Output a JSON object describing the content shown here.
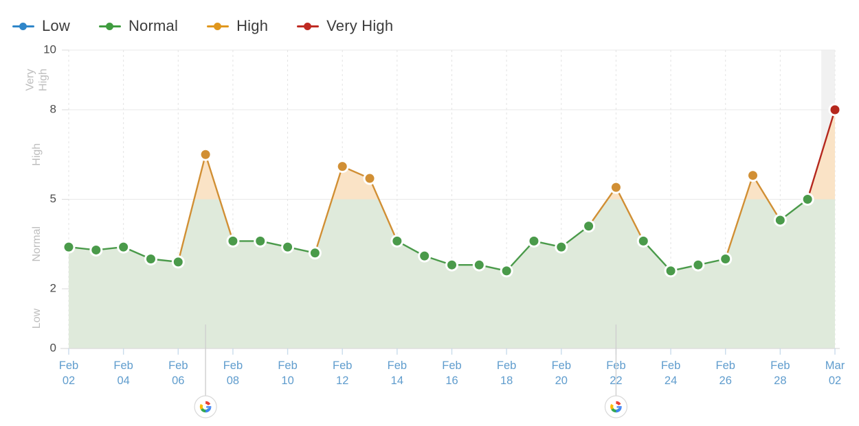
{
  "legend": {
    "items": [
      {
        "label": "Low",
        "color": "#2f86c9"
      },
      {
        "label": "Normal",
        "color": "#3f9c3f"
      },
      {
        "label": "High",
        "color": "#e0971d"
      },
      {
        "label": "Very High",
        "color": "#bf2a22"
      }
    ]
  },
  "colors": {
    "low_band": "#d5e4f0",
    "normal_band": "#dfeadb",
    "high_fill": "#fae3c6",
    "low_line": "#2f86c9",
    "normal_line": "#4a9a4a",
    "high_line": "#d18f34",
    "very_high_line": "#b5281e",
    "axis_label": "#5f9ccd",
    "grid": "#e8e8e8",
    "today_shade": "#ececec"
  },
  "chart_data": {
    "type": "line",
    "title": "",
    "xlabel": "",
    "ylabel": "",
    "ylim": [
      0,
      10
    ],
    "yticks": [
      0,
      2,
      5,
      8,
      10
    ],
    "grid": true,
    "legend_position": "top-left",
    "band_labels": [
      {
        "label": "Low",
        "from": 0,
        "to": 2
      },
      {
        "label": "Normal",
        "from": 2,
        "to": 5
      },
      {
        "label": "High",
        "from": 5,
        "to": 8
      },
      {
        "label": "Very High",
        "from": 8,
        "to": 10
      }
    ],
    "x_tick_labels": [
      "Feb\n02",
      "Feb\n04",
      "Feb\n06",
      "Feb\n08",
      "Feb\n10",
      "Feb\n12",
      "Feb\n14",
      "Feb\n16",
      "Feb\n18",
      "Feb\n20",
      "Feb\n22",
      "Feb\n24",
      "Feb\n26",
      "Feb\n28",
      "Mar\n02"
    ],
    "x": [
      "Feb 02",
      "Feb 03",
      "Feb 04",
      "Feb 05",
      "Feb 06",
      "Feb 07",
      "Feb 08",
      "Feb 09",
      "Feb 10",
      "Feb 11",
      "Feb 12",
      "Feb 13",
      "Feb 14",
      "Feb 15",
      "Feb 16",
      "Feb 17",
      "Feb 18",
      "Feb 19",
      "Feb 20",
      "Feb 21",
      "Feb 22",
      "Feb 23",
      "Feb 24",
      "Feb 25",
      "Feb 26",
      "Feb 27",
      "Feb 28",
      "Mar 01",
      "Mar 02"
    ],
    "values": [
      3.4,
      3.3,
      3.4,
      3.0,
      2.9,
      6.5,
      3.6,
      3.6,
      3.4,
      3.2,
      6.1,
      5.7,
      3.6,
      3.1,
      2.8,
      2.8,
      2.6,
      3.6,
      3.4,
      4.1,
      5.4,
      3.6,
      2.6,
      2.8,
      3.0,
      5.8,
      4.3,
      5.0,
      8.0
    ],
    "point_levels": [
      "normal",
      "normal",
      "normal",
      "normal",
      "normal",
      "high",
      "normal",
      "normal",
      "normal",
      "normal",
      "high",
      "high",
      "normal",
      "normal",
      "normal",
      "normal",
      "normal",
      "normal",
      "normal",
      "normal",
      "high",
      "normal",
      "normal",
      "normal",
      "normal",
      "high",
      "normal",
      "normal",
      "very_high"
    ],
    "events": [
      {
        "x": "Feb 07",
        "icon": "google-icon",
        "label": "Google update"
      },
      {
        "x": "Feb 22",
        "icon": "google-icon",
        "label": "Google update"
      }
    ],
    "today_marker": "Mar 02"
  }
}
